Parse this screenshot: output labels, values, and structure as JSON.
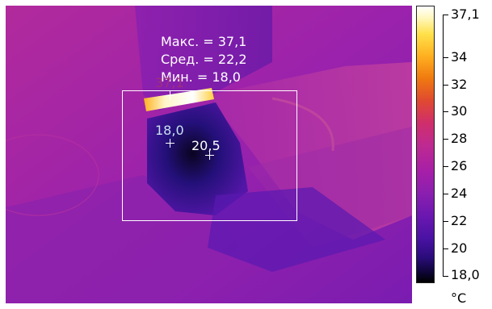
{
  "measurements": {
    "max_label": "Макс. = 37,1",
    "avg_label": "Сред. = 22,2",
    "min_label": "Мин. = 18,0"
  },
  "spots": {
    "max_value": "37,1",
    "min_value": "18,0",
    "spot_value": "20,5"
  },
  "scale": {
    "top_label": "37,1",
    "bottom_label": "18,0",
    "ticks": [
      "34",
      "32",
      "30",
      "28",
      "26",
      "24",
      "22",
      "20"
    ],
    "unit": "°C"
  },
  "colors": {
    "background_magenta": "#8a1fb0",
    "hot_white": "#ffffff",
    "hot_yellow": "#ffe14a",
    "cold_black": "#000000",
    "cold_blue": "#2a0c7a"
  }
}
